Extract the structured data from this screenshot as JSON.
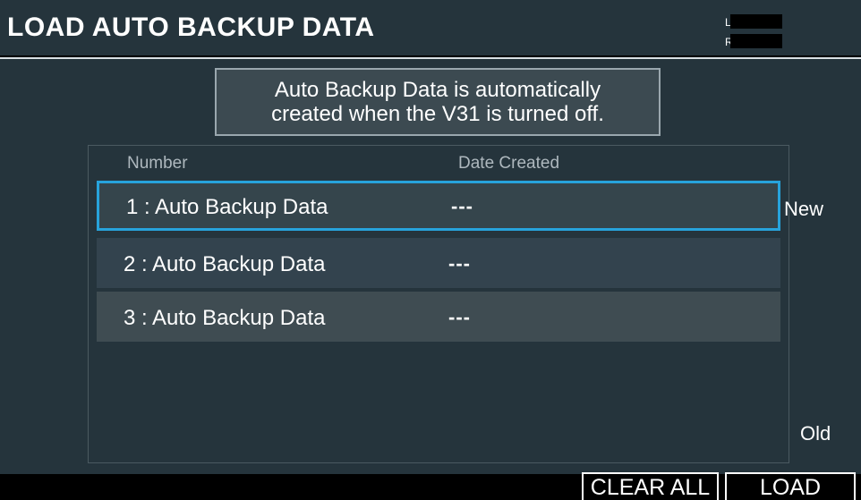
{
  "header": {
    "title": "LOAD AUTO BACKUP DATA",
    "meter_left_label": "L",
    "meter_right_label": "R"
  },
  "info": {
    "line1": "Auto Backup Data is automatically",
    "line2": "created when the V31 is turned off."
  },
  "list": {
    "col_number": "Number",
    "col_date": "Date Created",
    "selected_index": 0,
    "rows": [
      {
        "number": "1 :  Auto Backup Data",
        "date": "---"
      },
      {
        "number": "2 :  Auto Backup Data",
        "date": "---"
      },
      {
        "number": "3 :  Auto Backup Data",
        "date": "---"
      }
    ]
  },
  "side": {
    "new_label": "New",
    "old_label": "Old"
  },
  "footer": {
    "clear_all_label": "CLEAR ALL",
    "load_label": "LOAD"
  },
  "colors": {
    "panel_bg": "#25343c",
    "selection_border": "#27a3dc"
  }
}
